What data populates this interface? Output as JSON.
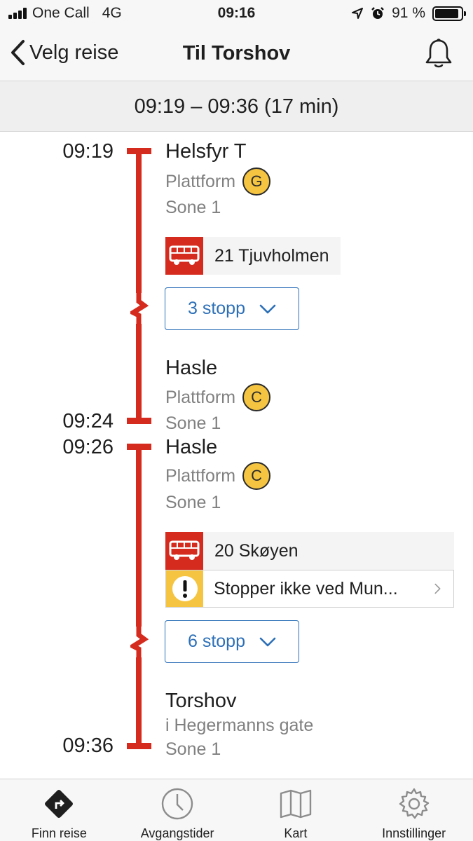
{
  "status_bar": {
    "carrier": "One Call",
    "network": "4G",
    "time": "09:16",
    "battery": "91 %",
    "battery_level": 0.91
  },
  "nav": {
    "back_label": "Velg reise",
    "title": "Til Torshov"
  },
  "summary": "09:19 – 09:36 (17 min)",
  "legs": [
    {
      "from": {
        "time": "09:19",
        "name": "Helsfyr T",
        "platform_label": "Plattform",
        "platform": "G",
        "zone": "Sone 1"
      },
      "line": "21 Tjuvholmen",
      "stops_button": "3 stopp",
      "to": {
        "time": "09:24",
        "name": "Hasle",
        "platform_label": "Plattform",
        "platform": "C",
        "zone": "Sone 1"
      }
    },
    {
      "from": {
        "time": "09:26",
        "name": "Hasle",
        "platform_label": "Plattform",
        "platform": "C",
        "zone": "Sone 1"
      },
      "line": "20 Skøyen",
      "alert": "Stopper ikke ved Mun...",
      "stops_button": "6 stopp",
      "to": {
        "time": "09:36",
        "name": "Torshov",
        "detail": "i Hegermanns gate",
        "zone": "Sone 1"
      }
    }
  ],
  "tabs": [
    {
      "label": "Finn reise",
      "icon": "directions-icon",
      "active": true
    },
    {
      "label": "Avgangstider",
      "icon": "clock-icon"
    },
    {
      "label": "Kart",
      "icon": "map-icon"
    },
    {
      "label": "Innstillinger",
      "icon": "gear-icon"
    }
  ],
  "colors": {
    "line_red": "#d52b1e",
    "platform_yellow": "#f5c542",
    "link_blue": "#2c6fb7"
  }
}
